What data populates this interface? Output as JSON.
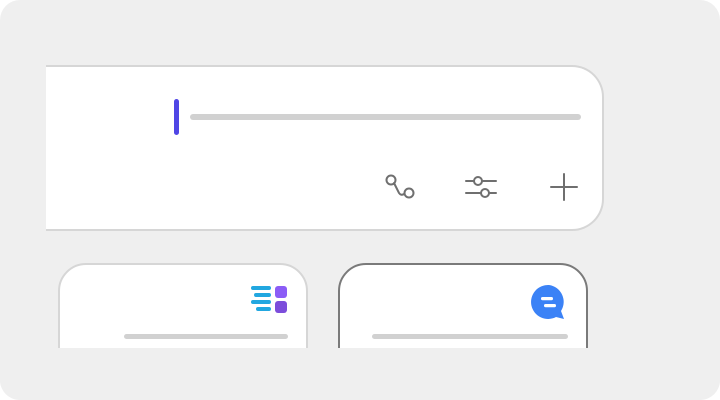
{
  "composer": {
    "input_value": "",
    "placeholder": "",
    "tools": [
      {
        "icon": "route-icon"
      },
      {
        "icon": "sliders-icon"
      },
      {
        "icon": "plus-icon"
      }
    ]
  },
  "cards": [
    {
      "title": "",
      "icon": "list-grid-icon"
    },
    {
      "title": "",
      "icon": "chat-bubble-icon"
    }
  ],
  "colors": {
    "background": "#efefef",
    "accent_caret": "#4f46e5",
    "icon_gray": "#6f6f6f",
    "list_icon_blue": "#22a7e0",
    "list_icon_purple": "#8b5cf6",
    "chat_bubble_blue": "#3b82f6"
  }
}
